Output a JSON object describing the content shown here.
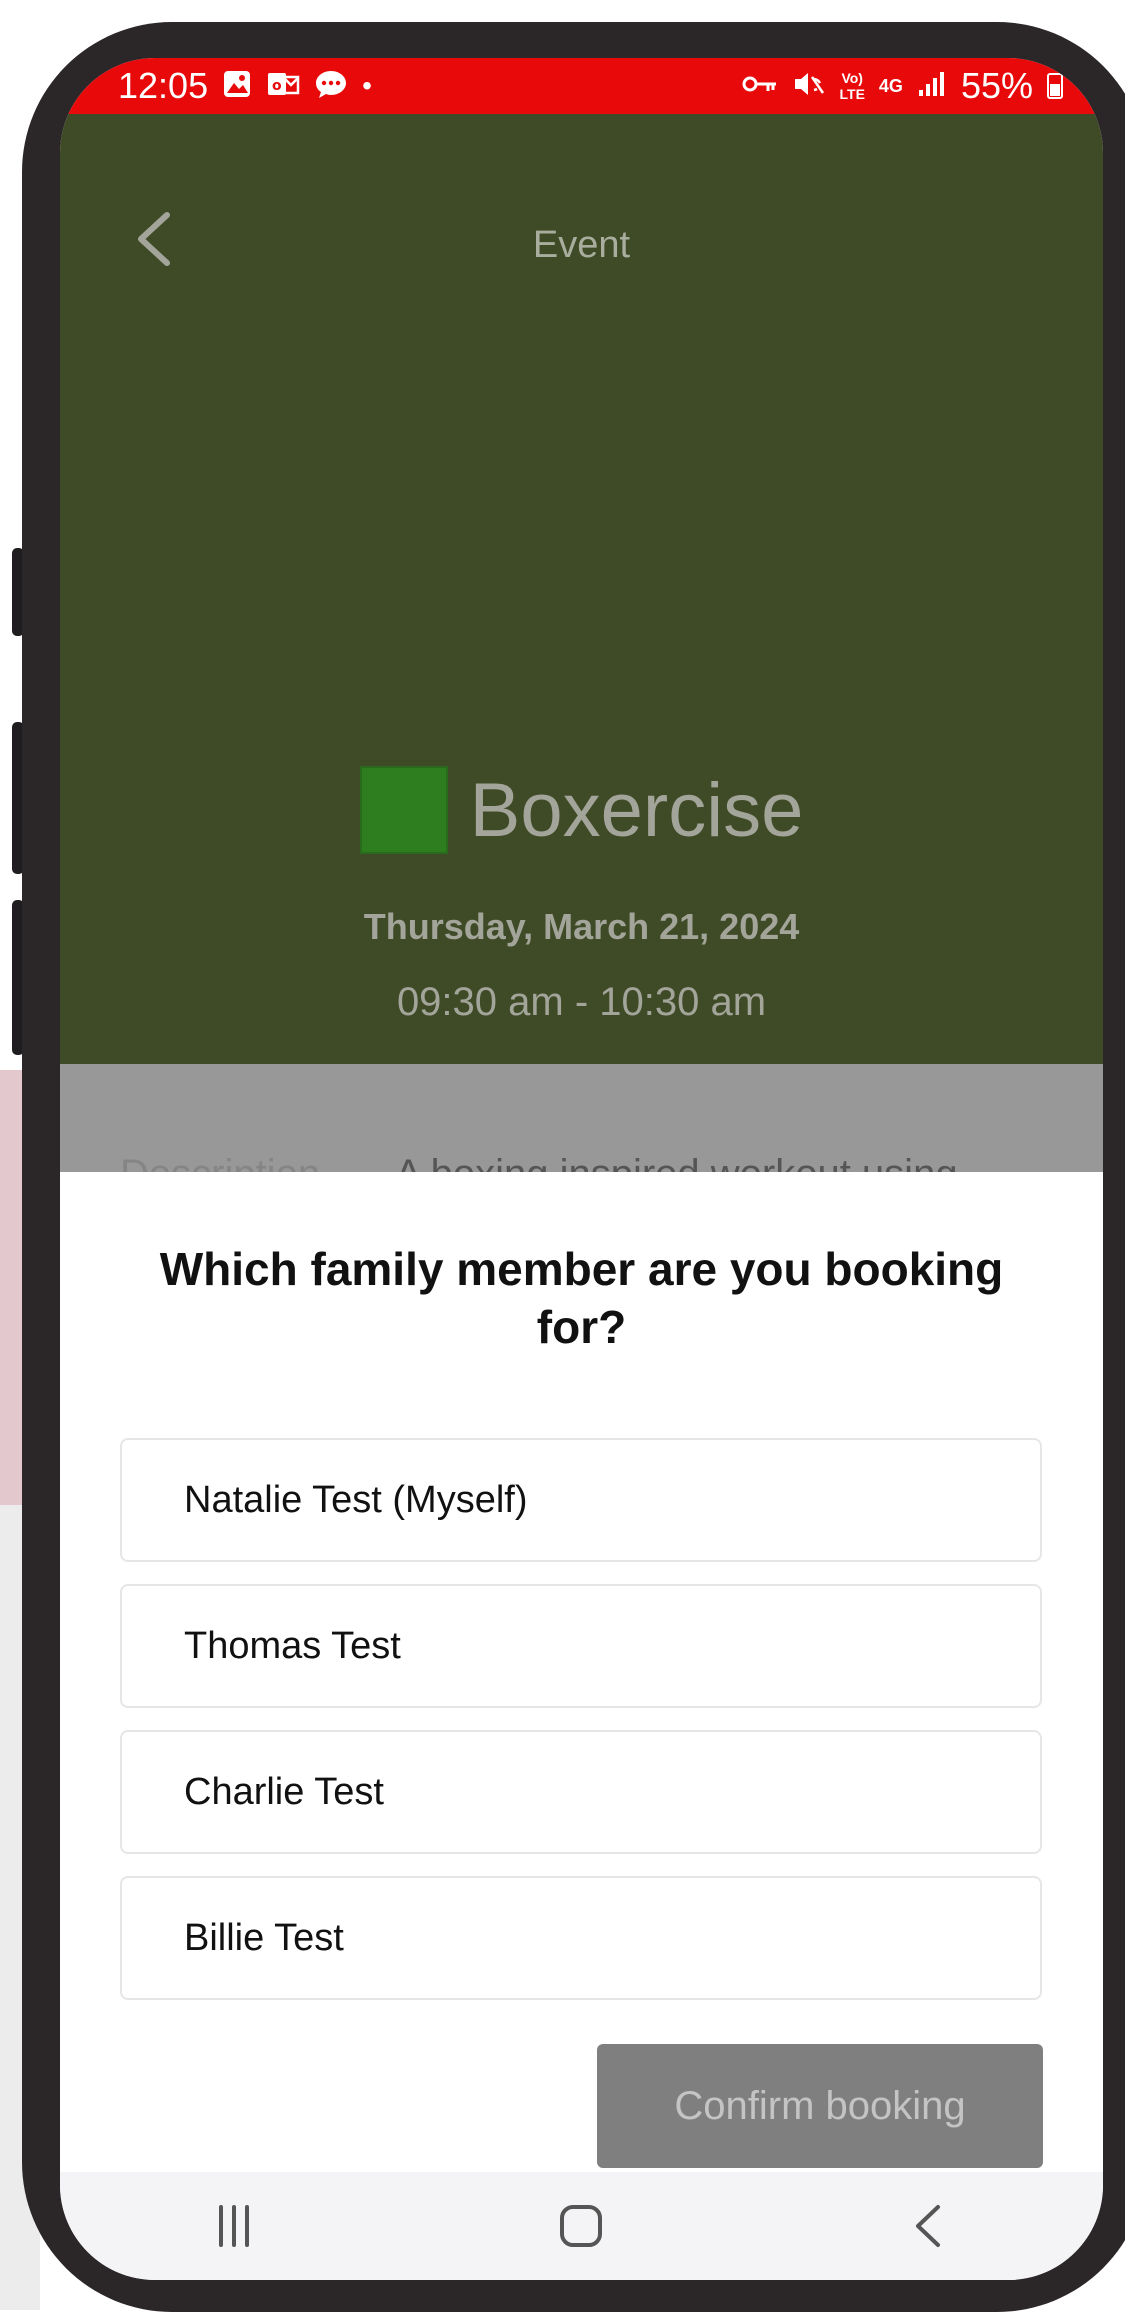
{
  "status_bar": {
    "time": "12:05",
    "dot": "•",
    "volte": "Vo)\nLTE",
    "network": "4G",
    "battery_percent": "55%"
  },
  "header": {
    "title": "Event"
  },
  "event": {
    "name": "Boxercise",
    "color": "#2e7d1e",
    "date": "Thursday, March 21, 2024",
    "time": "09:30 am - 10:30 am",
    "description_label": "Description",
    "description_text": "A boxing inspired workout using"
  },
  "sheet": {
    "title": "Which family member are you booking for?",
    "options": [
      "Natalie Test (Myself)",
      "Thomas Test",
      "Charlie Test",
      "Billie Test"
    ],
    "confirm_label": "Confirm booking"
  },
  "nav": {
    "recents_icon": "recents-icon",
    "home_icon": "home-icon",
    "back_icon": "back-icon"
  },
  "colors": {
    "status_bar": "#e8090b",
    "header_bg": "#3f4b27",
    "confirm_bg": "#7f7f7f"
  }
}
